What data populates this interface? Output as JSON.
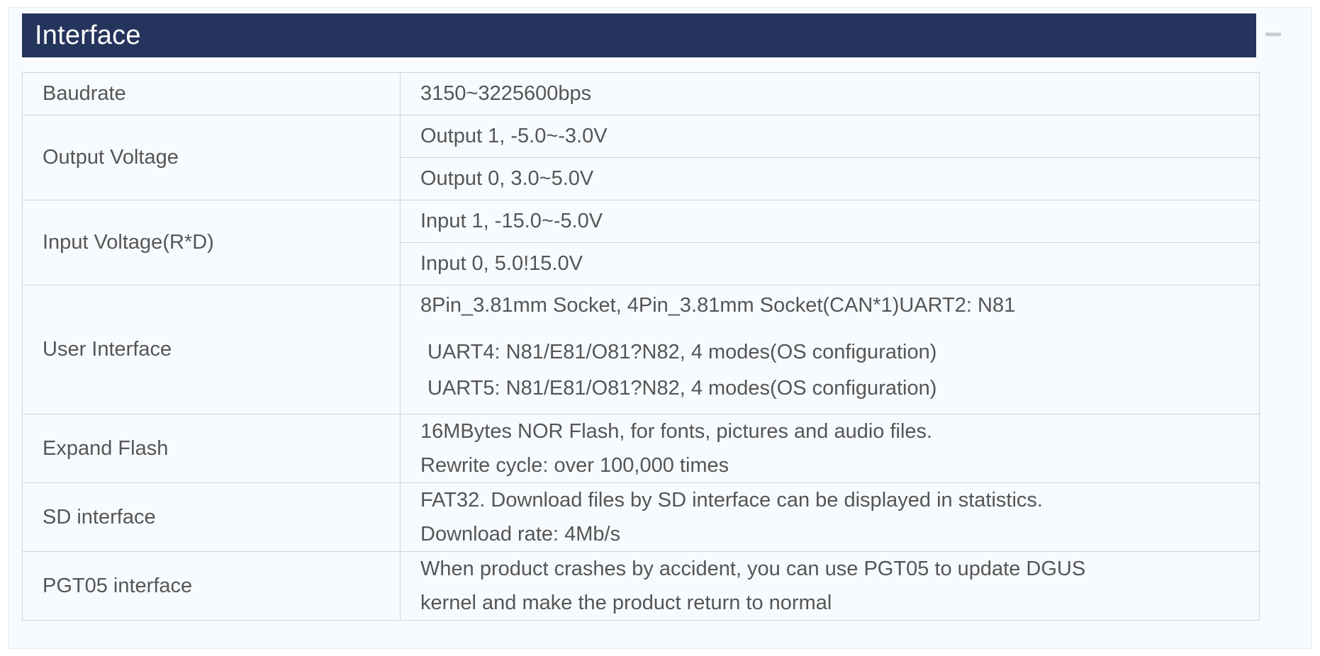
{
  "section": {
    "title": "Interface",
    "collapse_icon": "minus-icon"
  },
  "rows": {
    "baudrate": {
      "label": "Baudrate",
      "value": "3150~3225600bps"
    },
    "output_voltage": {
      "label": "Output Voltage",
      "values": [
        "Output 1, -5.0~-3.0V",
        "Output 0, 3.0~5.0V"
      ]
    },
    "input_voltage": {
      "label": "Input Voltage(R*D)",
      "values": [
        "Input 1, -15.0~-5.0V",
        "Input 0, 5.0!15.0V"
      ]
    },
    "user_interface": {
      "label": "User Interface",
      "lines": [
        "8Pin_3.81mm Socket, 4Pin_3.81mm Socket(CAN*1)UART2: N81",
        "UART4: N81/E81/O81?N82, 4 modes(OS configuration)",
        "UART5: N81/E81/O81?N82, 4 modes(OS configuration)"
      ]
    },
    "expand_flash": {
      "label": "Expand Flash",
      "lines": [
        "16MBytes NOR Flash, for fonts, pictures and audio files.",
        "Rewrite cycle: over 100,000 times"
      ]
    },
    "sd_interface": {
      "label": "SD interface",
      "lines": [
        "FAT32. Download files by SD interface can be displayed in statistics.",
        "Download rate: 4Mb/s"
      ]
    },
    "pgt05_interface": {
      "label": "PGT05 interface",
      "lines": [
        "When product crashes by accident, you can use PGT05 to update DGUS",
        "kernel and make the product return to normal"
      ]
    }
  },
  "colors": {
    "header_bg": "#25345c",
    "header_text": "#ffffff",
    "panel_bg": "#f7fbff",
    "border": "#cfd4d9",
    "text": "#555555"
  }
}
